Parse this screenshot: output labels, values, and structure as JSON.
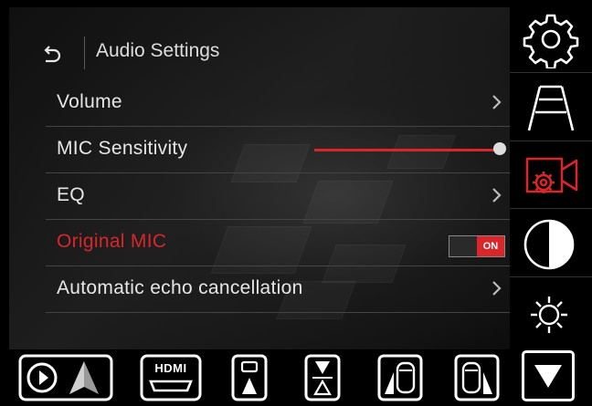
{
  "header": {
    "title": "Audio Settings",
    "back_icon": "back-arrow-icon"
  },
  "menu": {
    "items": [
      {
        "label": "Volume",
        "control": "chevron"
      },
      {
        "label": "MIC Sensitivity",
        "control": "slider",
        "value": 1.0
      },
      {
        "label": "EQ",
        "control": "chevron"
      },
      {
        "label": "Original MIC",
        "control": "toggle",
        "toggle_text": "ON",
        "state": "on",
        "highlighted": true
      },
      {
        "label": "Automatic echo cancellation",
        "control": "chevron"
      }
    ]
  },
  "sidebar": {
    "items": [
      {
        "icon": "gear-icon",
        "selected": false
      },
      {
        "icon": "lane-guide-icon",
        "selected": false
      },
      {
        "icon": "camera-settings-icon",
        "selected": true
      },
      {
        "icon": "contrast-icon",
        "selected": false
      },
      {
        "icon": "brightness-icon",
        "selected": false
      }
    ],
    "down_icon": "arrow-down-icon"
  },
  "bottom_bar": {
    "items": [
      {
        "icon": "carplay-android-auto-icon",
        "label": ""
      },
      {
        "icon": "hdmi-icon",
        "label": "HDMI"
      },
      {
        "icon": "front-camera-view-icon",
        "label": ""
      },
      {
        "icon": "front-rear-split-view-icon",
        "label": ""
      },
      {
        "icon": "left-camera-view-icon",
        "label": ""
      },
      {
        "icon": "right-camera-view-icon",
        "label": ""
      }
    ]
  },
  "colors": {
    "accent": "#d8262b",
    "text": "#e6e6e6",
    "background": "#000000",
    "divider": "#444444"
  }
}
